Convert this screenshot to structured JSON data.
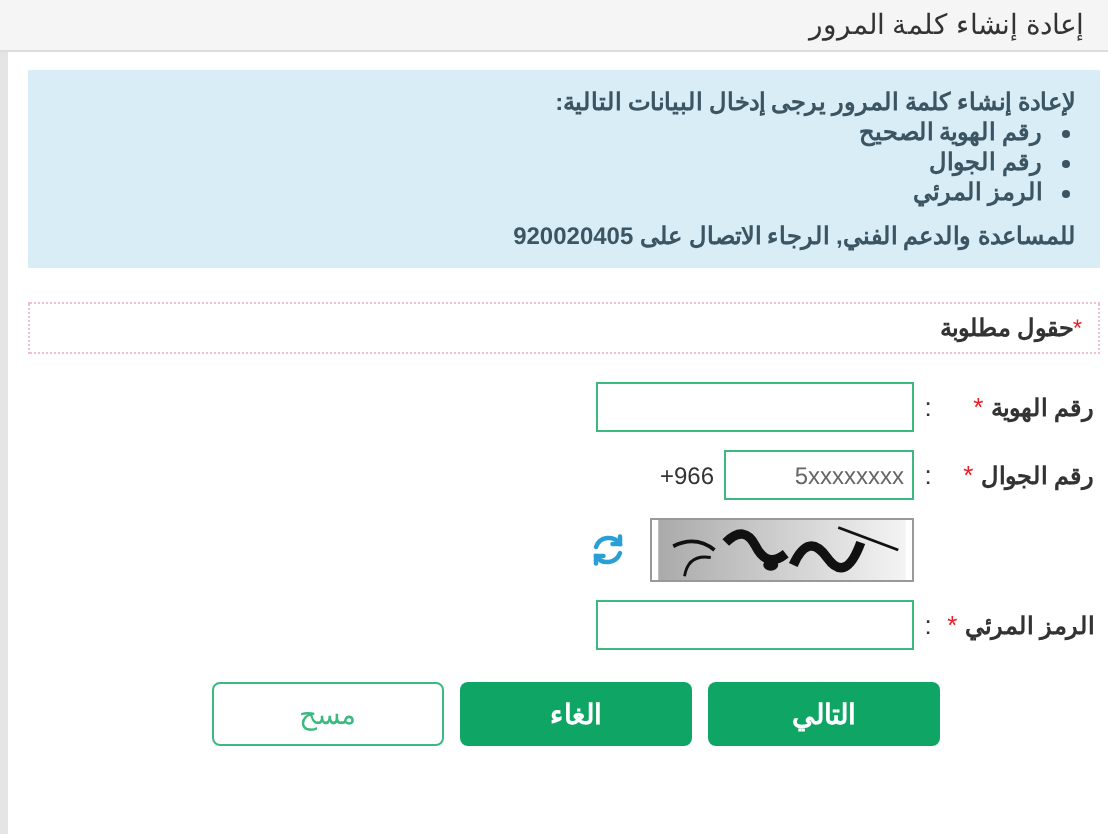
{
  "title": "إعادة إنشاء كلمة المرور",
  "info": {
    "intro": "لإعادة إنشاء كلمة المرور يرجى إدخال البيانات التالية:",
    "items": [
      "رقم الهوية الصحيح",
      "رقم الجوال",
      "الرمز المرئي"
    ],
    "support": "للمساعدة والدعم الفني, الرجاء الاتصال على 920020405"
  },
  "required_note": {
    "mark": "*",
    "text": "حقول مطلوبة"
  },
  "fields": [
    {
      "kind": "text",
      "label": "رقم الهوية",
      "mark": "*",
      "separator": ":"
    },
    {
      "kind": "phone",
      "label": "رقم الجوال",
      "mark": "*",
      "separator": ":",
      "placeholder": "5xxxxxxxx",
      "prefix": "+966"
    },
    {
      "kind": "captcha"
    },
    {
      "kind": "text",
      "label": "الرمز المرئي",
      "mark": "*",
      "separator": ":"
    }
  ],
  "buttons": [
    {
      "label": "التالي",
      "kind": "primary"
    },
    {
      "label": "الغاء",
      "kind": "primary"
    },
    {
      "label": "مسح",
      "kind": "outline"
    }
  ]
}
